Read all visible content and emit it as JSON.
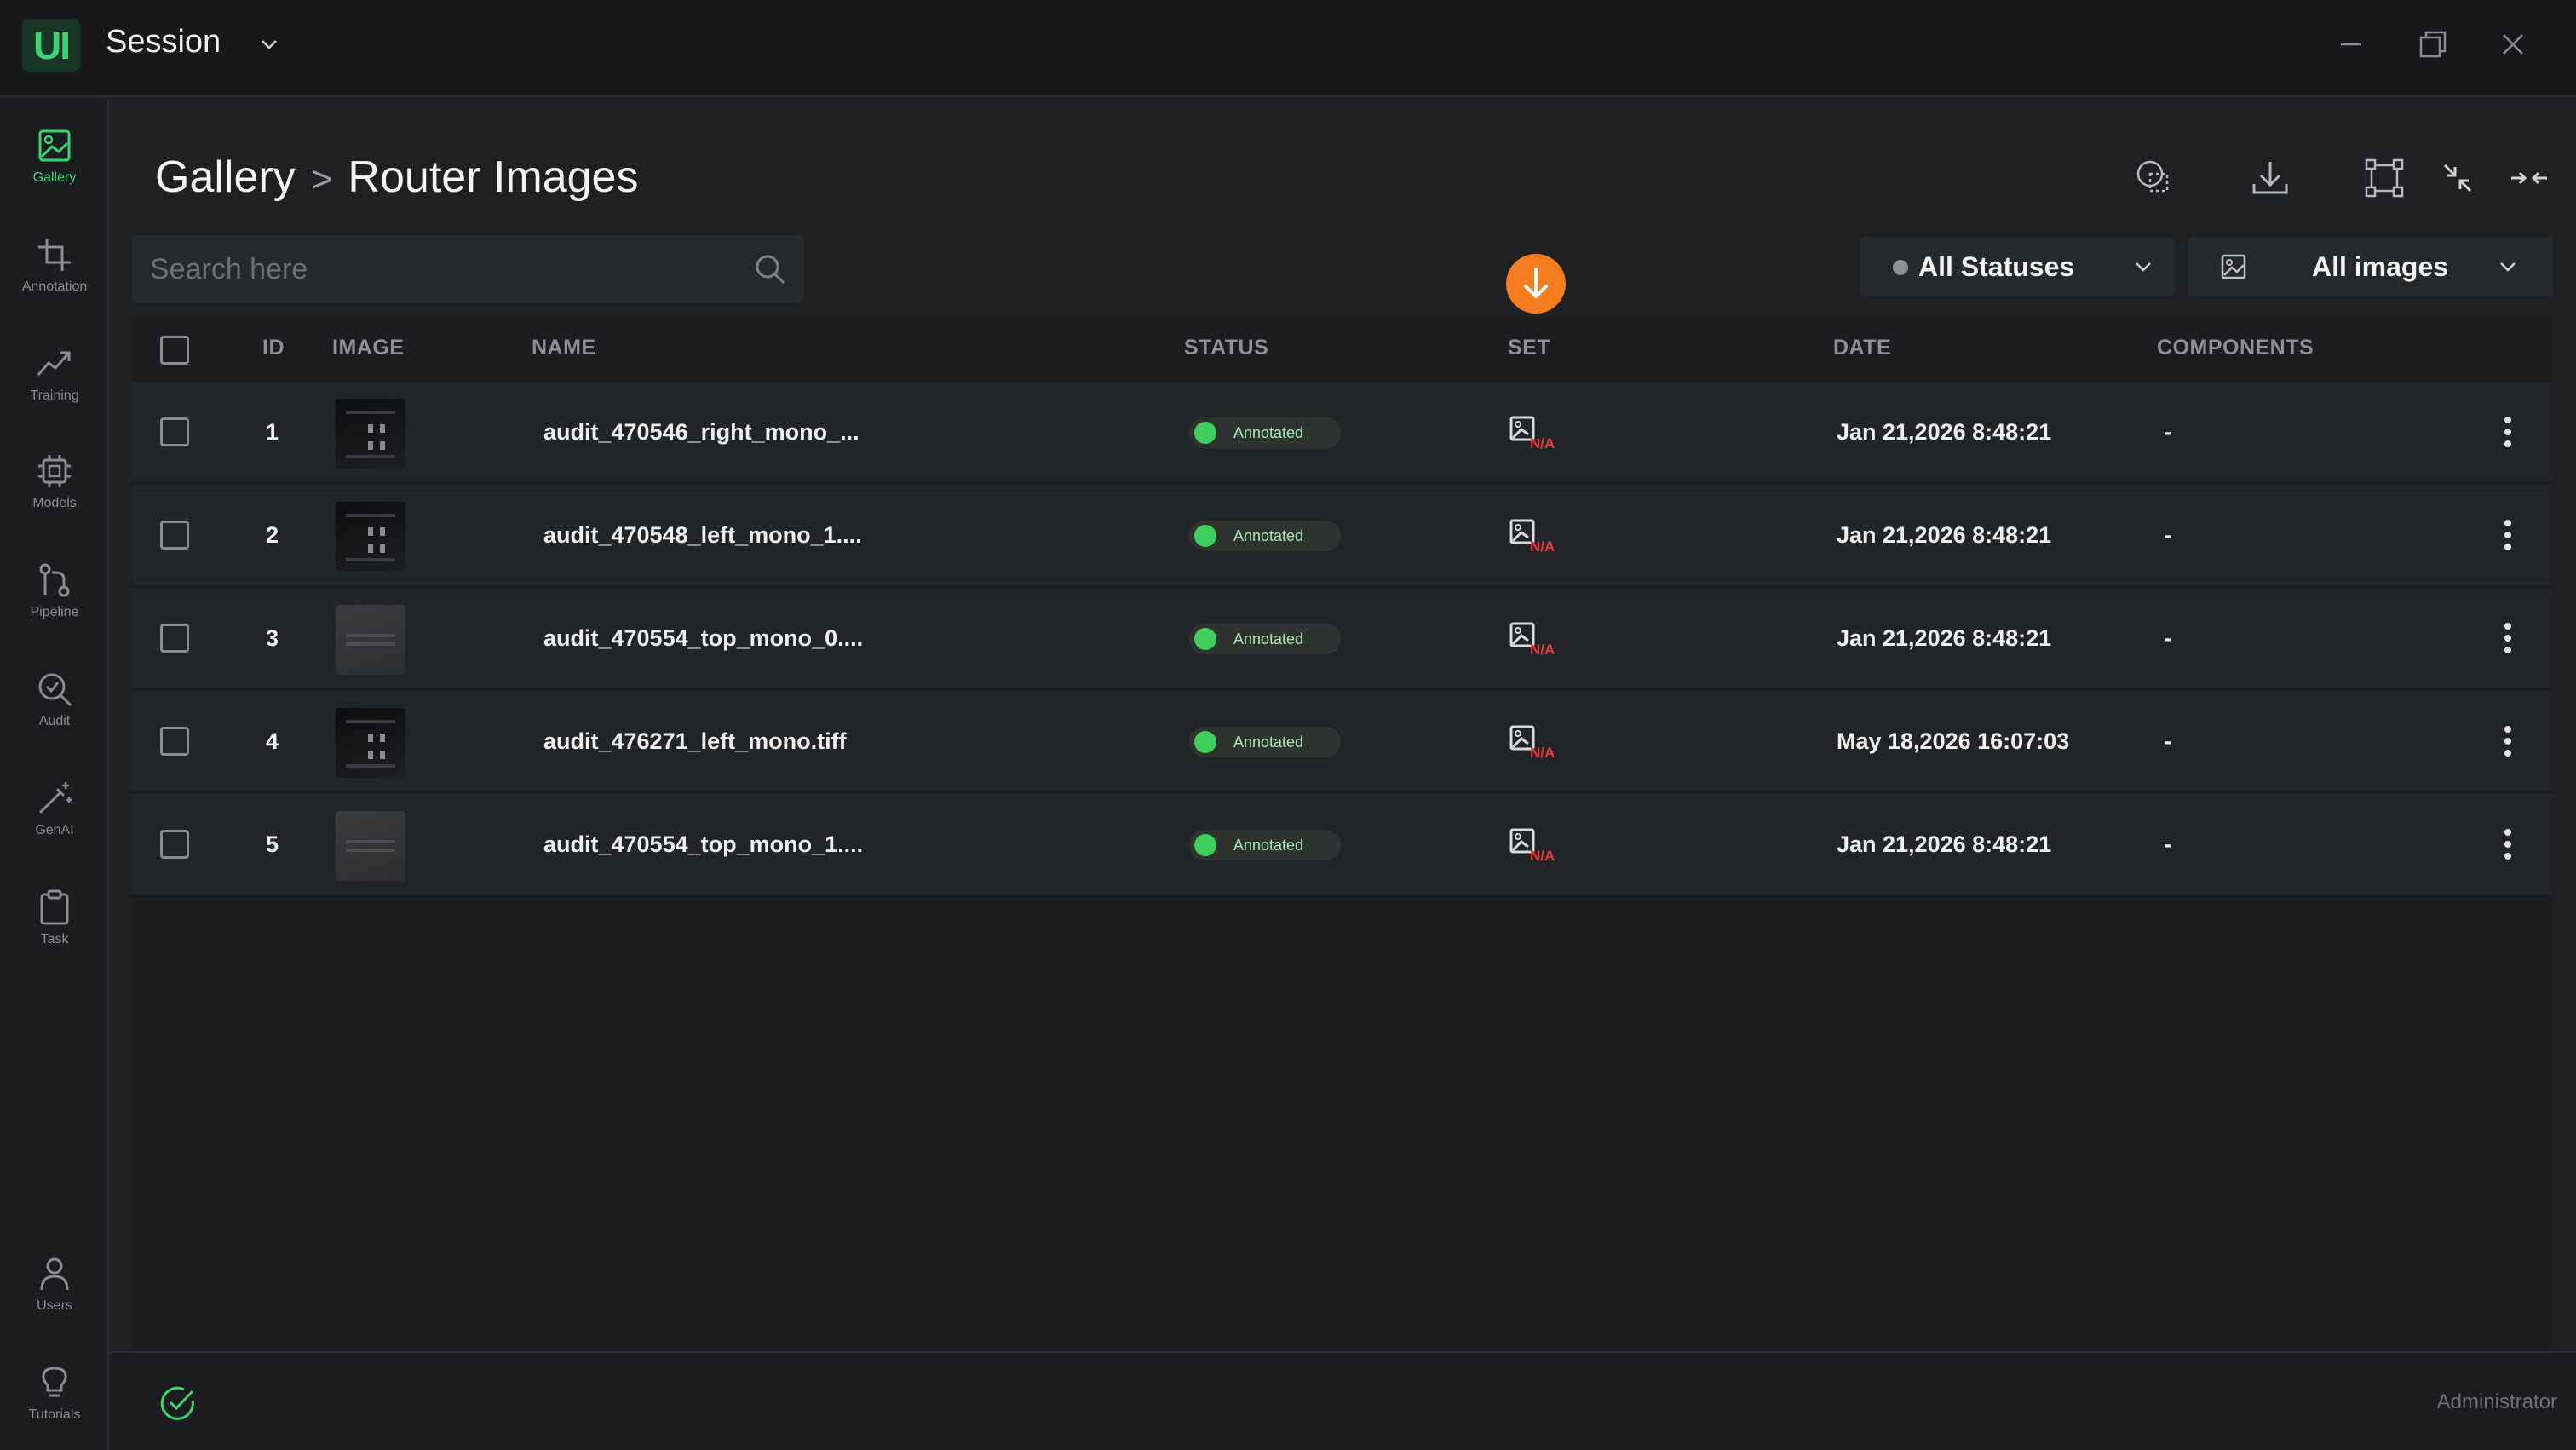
{
  "app": {
    "logo": "UI",
    "title": "Session"
  },
  "sidebar": {
    "items": [
      {
        "label": "Gallery",
        "icon": "gallery-icon",
        "active": true
      },
      {
        "label": "Annotation",
        "icon": "crop-icon",
        "active": false
      },
      {
        "label": "Training",
        "icon": "trend-up-icon",
        "active": false
      },
      {
        "label": "Models",
        "icon": "chip-icon",
        "active": false
      },
      {
        "label": "Pipeline",
        "icon": "pipeline-icon",
        "active": false
      },
      {
        "label": "Audit",
        "icon": "audit-search-icon",
        "active": false
      },
      {
        "label": "GenAI",
        "icon": "magic-wand-icon",
        "active": false
      },
      {
        "label": "Task",
        "icon": "clipboard-icon",
        "active": false
      },
      {
        "label": "Users",
        "icon": "user-icon",
        "active": false
      },
      {
        "label": "Tutorials",
        "icon": "lightbulb-icon",
        "active": false
      }
    ]
  },
  "breadcrumb": {
    "root": "Gallery",
    "separator": ">",
    "current": "Router Images"
  },
  "search": {
    "placeholder": "Search here",
    "value": ""
  },
  "filters": {
    "status": "All Statuses",
    "images": "All images"
  },
  "table": {
    "headers": {
      "id": "ID",
      "image": "IMAGE",
      "name": "NAME",
      "status": "STATUS",
      "set": "SET",
      "date": "DATE",
      "components": "COMPONENTS"
    },
    "rows": [
      {
        "id": "1",
        "name": "audit_470546_right_mono_...",
        "status": "Annotated",
        "set": "N/A",
        "date": "Jan 21,2026 8:48:21",
        "components": "-",
        "thumb": "dark"
      },
      {
        "id": "2",
        "name": "audit_470548_left_mono_1....",
        "status": "Annotated",
        "set": "N/A",
        "date": "Jan 21,2026 8:48:21",
        "components": "-",
        "thumb": "dark"
      },
      {
        "id": "3",
        "name": "audit_470554_top_mono_0....",
        "status": "Annotated",
        "set": "N/A",
        "date": "Jan 21,2026 8:48:21",
        "components": "-",
        "thumb": "gray"
      },
      {
        "id": "4",
        "name": "audit_476271_left_mono.tiff",
        "status": "Annotated",
        "set": "N/A",
        "date": "May 18,2026 16:07:03",
        "components": "-",
        "thumb": "dark"
      },
      {
        "id": "5",
        "name": "audit_470554_top_mono_1....",
        "status": "Annotated",
        "set": "N/A",
        "date": "Jan 21,2026 8:48:21",
        "components": "-",
        "thumb": "gray"
      }
    ]
  },
  "footer": {
    "role": "Administrator"
  },
  "colors": {
    "accent": "#3fd275",
    "status_annotated": "#3ecf5d",
    "fab": "#f57c1f",
    "na_red": "#e5393b"
  }
}
